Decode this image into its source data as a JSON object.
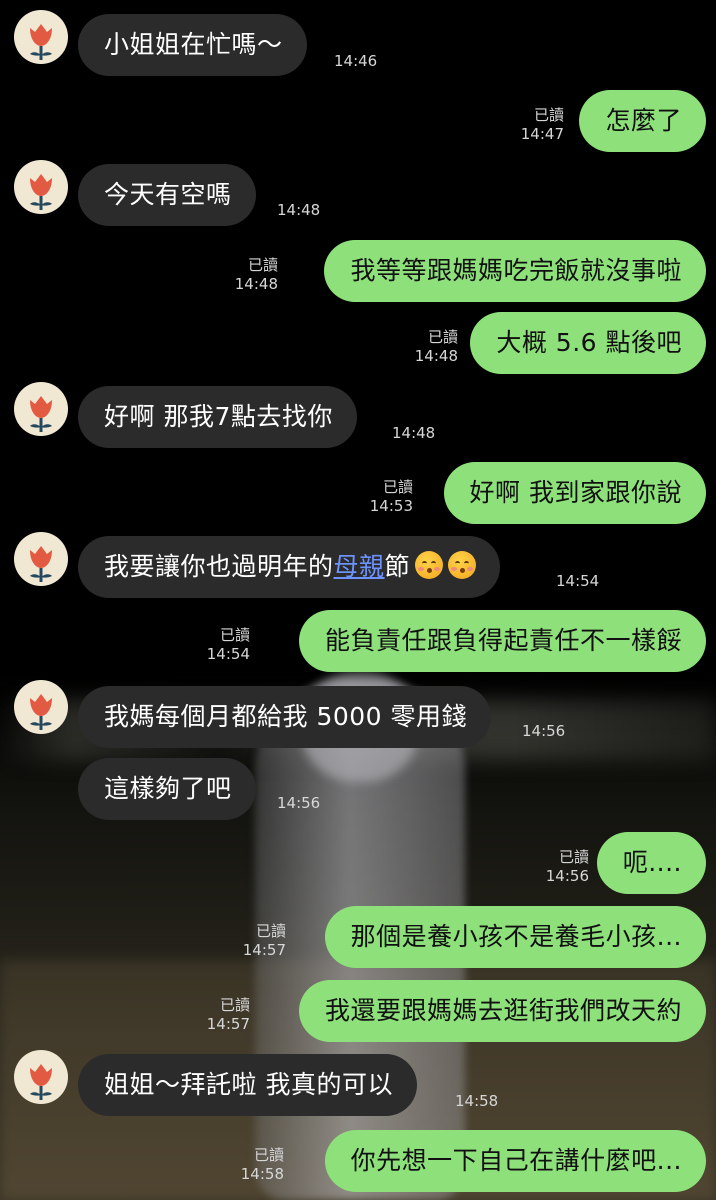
{
  "read_label": "已讀",
  "messages": [
    {
      "side": "in",
      "text": "小姐姐在忙嗎～",
      "time": "14:46"
    },
    {
      "side": "out",
      "text": "怎麼了",
      "time": "14:47"
    },
    {
      "side": "in",
      "text": "今天有空嗎",
      "time": "14:48"
    },
    {
      "side": "out",
      "text": "我等等跟媽媽吃完飯就沒事啦",
      "time": "14:48"
    },
    {
      "side": "out",
      "text": "大概 5.6 點後吧",
      "time": "14:48"
    },
    {
      "side": "in",
      "text": "好啊 那我7點去找你",
      "time": "14:48"
    },
    {
      "side": "out",
      "text": "好啊 我到家跟你說",
      "time": "14:53"
    },
    {
      "side": "in",
      "text_before": "我要讓你也過明年的",
      "link_text": "母親",
      "text_after": "節",
      "emoji": "kissing-face-with-closed-eyes",
      "time": "14:54"
    },
    {
      "side": "out",
      "text": "能負責任跟負得起責任不一樣餒",
      "time": "14:54"
    },
    {
      "side": "in",
      "text": "我媽每個月都給我 5000 零用錢",
      "time": "14:56"
    },
    {
      "side": "in",
      "text": "這樣夠了吧",
      "time": "14:56"
    },
    {
      "side": "out",
      "text": "呃....",
      "time": "14:56"
    },
    {
      "side": "out",
      "text": "那個是養小孩不是養毛小孩...",
      "time": "14:57"
    },
    {
      "side": "out",
      "text": "我還要跟媽媽去逛街我們改天約",
      "time": "14:57"
    },
    {
      "side": "in",
      "text": "姐姐～拜託啦 我真的可以",
      "time": "14:58"
    },
    {
      "side": "out",
      "text": "你先想一下自己在講什麼吧...",
      "time": "14:58"
    }
  ],
  "colors": {
    "incoming_bubble": "#2b2b2b",
    "outgoing_bubble": "#8de07a",
    "link": "#6c93ff",
    "background": "#000000"
  },
  "avatar_icon": "red-flower-icon"
}
